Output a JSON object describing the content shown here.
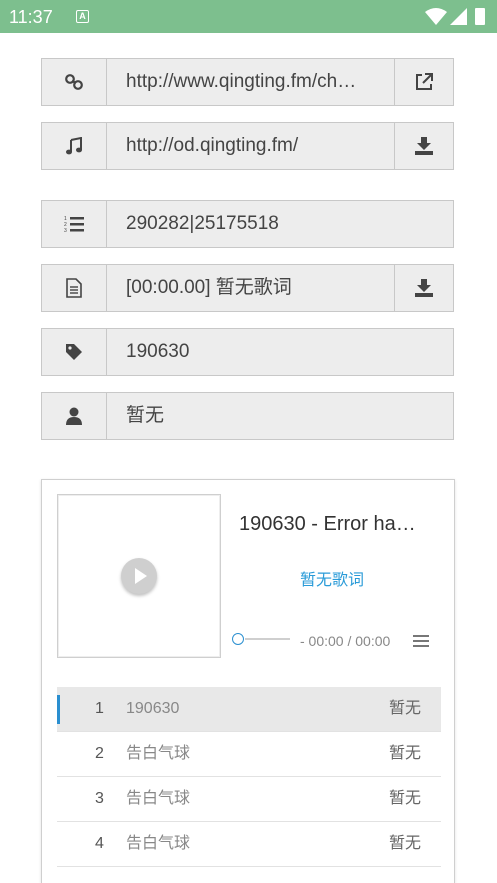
{
  "status_bar": {
    "time": "11:37",
    "notification_letter": "A"
  },
  "fields": {
    "link_url": "http://www.qingting.fm/ch…",
    "audio_url": "http://od.qingting.fm/",
    "list_id": "290282|25175518",
    "lyric": "[00:00.00] 暂无歌词",
    "tag": "190630",
    "artist": "暂无"
  },
  "player": {
    "title": "190630 - Error ha…",
    "lyrics_status": "暂无歌词",
    "time_display": "- 00:00 / 00:00",
    "progress": 0
  },
  "playlist": [
    {
      "index": "1",
      "title": "190630",
      "artist": "暂无",
      "active": true
    },
    {
      "index": "2",
      "title": "告白气球",
      "artist": "暂无",
      "active": false
    },
    {
      "index": "3",
      "title": "告白气球",
      "artist": "暂无",
      "active": false
    },
    {
      "index": "4",
      "title": "告白气球",
      "artist": "暂无",
      "active": false
    }
  ],
  "colors": {
    "status_bar": "#7dbf8e",
    "accent": "#2a9bd8",
    "field_bg": "#ededed"
  },
  "icons": {
    "row1": "link-icon",
    "row1_action": "external-link-icon",
    "row2": "music-note-icon",
    "row2_action": "download-icon",
    "row3": "ordered-list-icon",
    "row4": "document-icon",
    "row4_action": "download-icon",
    "row5": "tag-icon",
    "row6": "user-icon"
  }
}
